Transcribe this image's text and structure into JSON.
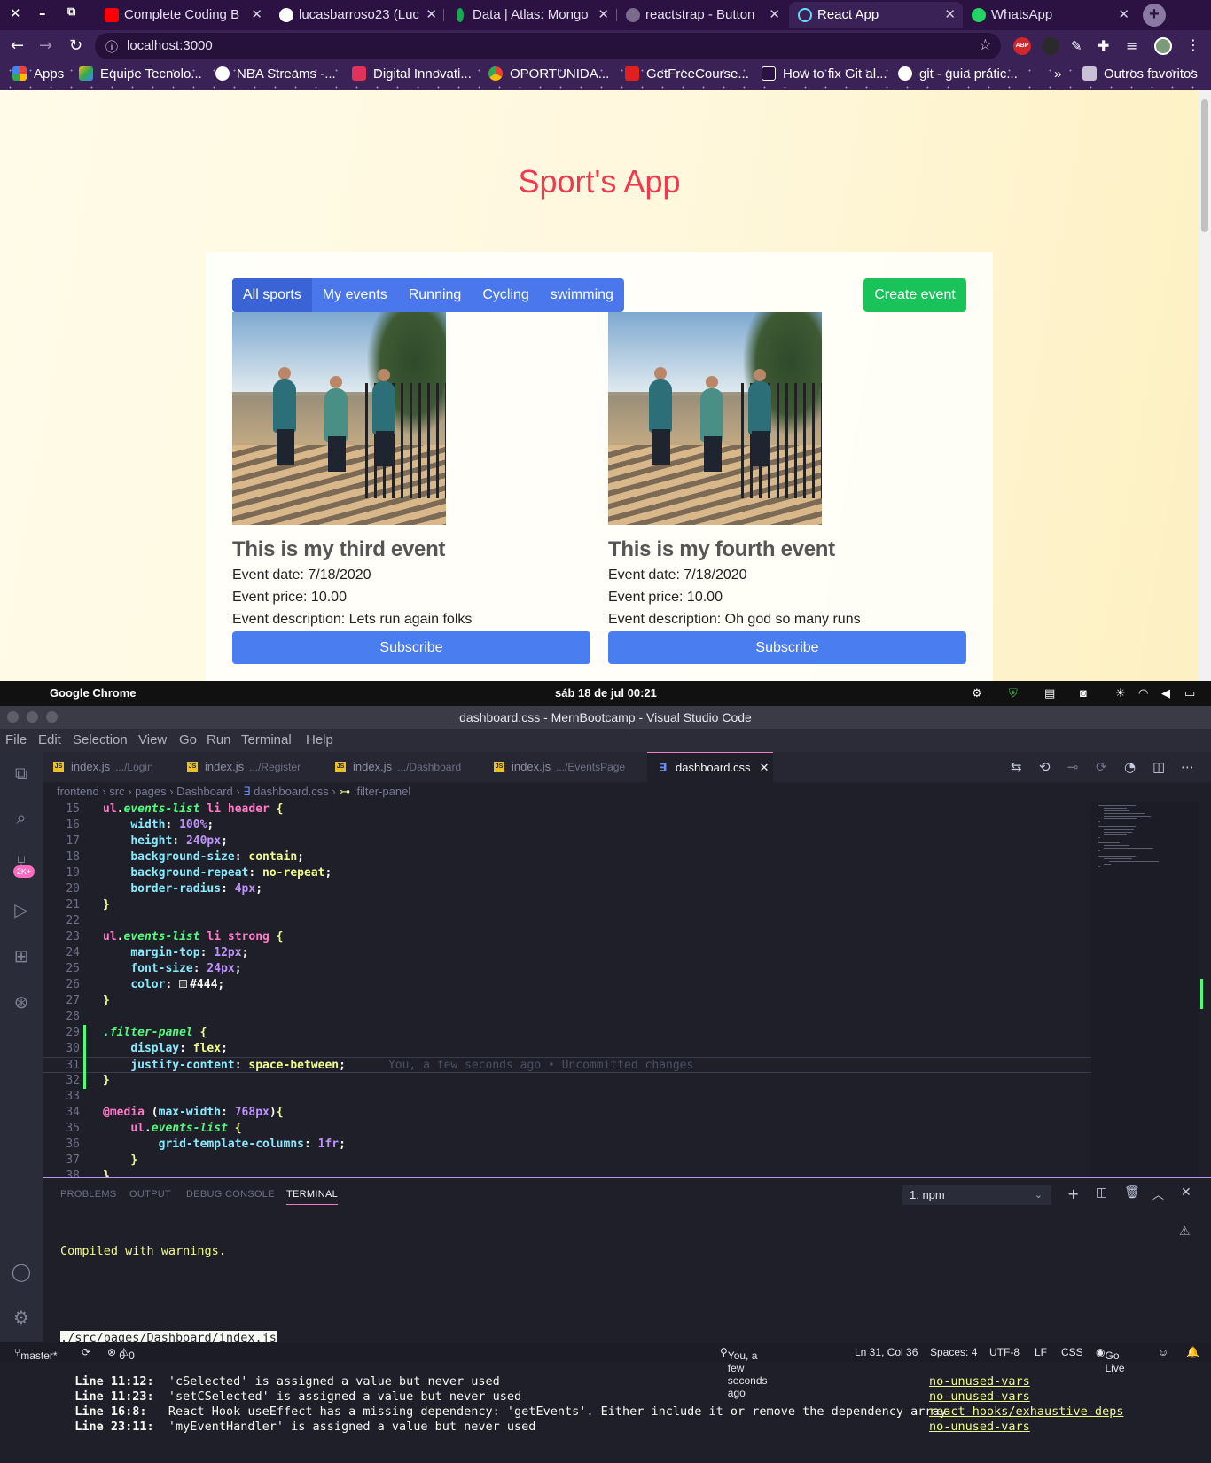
{
  "browser": {
    "tabs": [
      {
        "title": "Complete Coding B",
        "icon": "youtube-icon",
        "color": "#ff0000"
      },
      {
        "title": "lucasbarroso23 (Luc",
        "icon": "github-icon",
        "color": "#ffffff"
      },
      {
        "title": "Data | Atlas: Mongo",
        "icon": "mongodb-leaf-icon",
        "color": "#13aa52"
      },
      {
        "title": "reactstrap - Button",
        "icon": "gear-icon",
        "color": "#7a6a8c"
      },
      {
        "title": "React App",
        "icon": "react-icon",
        "color": "#61dafb"
      },
      {
        "title": "WhatsApp",
        "icon": "whatsapp-icon",
        "color": "#25d366"
      }
    ],
    "url": "localhost:3000",
    "bookmarks": [
      {
        "label": "Apps",
        "icon": "apps-grid-icon",
        "color": "#ea4335"
      },
      {
        "label": "Equipe Tecnolo...",
        "icon": "google-drive-icon",
        "color": "#fbbc04"
      },
      {
        "label": "NBA Streams -...",
        "icon": "globe-icon",
        "color": "#ffffff"
      },
      {
        "label": "Digital Innovati...",
        "icon": "dio-icon",
        "color": "#e0325a"
      },
      {
        "label": "OPORTUNIDA...",
        "icon": "chrome-icon",
        "color": "#34a853"
      },
      {
        "label": "GetFreeCourse...",
        "icon": "gfc-icon",
        "color": "#e02020"
      },
      {
        "label": "How to fix Git al...",
        "icon": "freecodecamp-icon",
        "color": "#2b1242"
      },
      {
        "label": "git - guia prátic...",
        "icon": "globe-icon",
        "color": "#ffffff"
      }
    ],
    "more_bookmarks": "»",
    "other_favorites": "Outros favoritos"
  },
  "app": {
    "title": "Sport's App",
    "filters": [
      "All sports",
      "My events",
      "Running",
      "Cycling",
      "swimming"
    ],
    "create_label": "Create event",
    "events": [
      {
        "title": "This is my third event",
        "date": "Event date: 7/18/2020",
        "price": "Event price: 10.00",
        "description": "Event description: Lets run again folks",
        "button": "Subscribe"
      },
      {
        "title": "This is my fourth event",
        "date": "Event date: 7/18/2020",
        "price": "Event price: 10.00",
        "description": "Event description: Oh god so many runs",
        "button": "Subscribe"
      }
    ]
  },
  "os": {
    "app_name": "Google Chrome",
    "clock": "sáb 18 de jul  00:21"
  },
  "vscode": {
    "window_title": "dashboard.css - MernBootcamp - Visual Studio Code",
    "menu": [
      "File",
      "Edit",
      "Selection",
      "View",
      "Go",
      "Run",
      "Terminal",
      "Help"
    ],
    "tabs": [
      {
        "name": "index.js",
        "path": ".../Login"
      },
      {
        "name": "index.js",
        "path": ".../Register"
      },
      {
        "name": "index.js",
        "path": ".../Dashboard"
      },
      {
        "name": "index.js",
        "path": ".../EventsPage"
      },
      {
        "name": "dashboard.css",
        "path": ""
      }
    ],
    "breadcrumb": [
      "frontend",
      "src",
      "pages",
      "Dashboard",
      "dashboard.css",
      ".filter-panel"
    ],
    "scm_badge": "2K+",
    "line_numbers": [
      "15",
      "16",
      "17",
      "18",
      "19",
      "20",
      "21",
      "22",
      "23",
      "24",
      "25",
      "26",
      "27",
      "28",
      "29",
      "30",
      "31",
      "32",
      "33",
      "34",
      "35",
      "36",
      "37",
      "38"
    ],
    "code_lines": [
      "ul.events-list li header {",
      "    width: 100%;",
      "    height: 240px;",
      "    background-size: contain;",
      "    background-repeat: no-repeat;",
      "    border-radius: 4px;",
      "}",
      "",
      "ul.events-list li strong {",
      "    margin-top: 12px;",
      "    font-size: 24px;",
      "    color: #444;",
      "}",
      "",
      ".filter-panel {",
      "    display: flex;",
      "    justify-content: space-between;",
      "}",
      "",
      "@media (max-width: 768px){",
      "    ul.events-list {",
      "        grid-template-columns: 1fr;",
      "    }",
      "}"
    ],
    "blame": "You, a few seconds ago • Uncommitted changes",
    "panel_tabs": [
      "PROBLEMS",
      "OUTPUT",
      "DEBUG CONSOLE",
      "TERMINAL"
    ],
    "terminal_select": "1: npm",
    "terminal": {
      "compiled": "Compiled with warnings.",
      "file": "./src/pages/Dashboard/index.js",
      "warnings": [
        {
          "loc": "Line 11:12:",
          "msg": "'cSelected' is assigned a value but never used",
          "rule": "no-unused-vars"
        },
        {
          "loc": "Line 11:23:",
          "msg": "'setCSelected' is assigned a value but never used",
          "rule": "no-unused-vars"
        },
        {
          "loc": "Line 16:8:",
          "msg": "React Hook useEffect has a missing dependency: 'getEvents'. Either include it or remove the dependency array",
          "rule": "react-hooks/exhaustive-deps"
        },
        {
          "loc": "Line 23:11:",
          "msg": "'myEventHandler' is assigned a value but never used",
          "rule": "no-unused-vars"
        }
      ]
    },
    "status": {
      "branch": "master*",
      "errors": "0",
      "warnings": "0",
      "blame": "You, a few seconds ago",
      "position": "Ln 31, Col 36",
      "spaces": "Spaces: 4",
      "encoding": "UTF-8",
      "eol": "LF",
      "language": "CSS",
      "golive": "Go Live"
    }
  }
}
